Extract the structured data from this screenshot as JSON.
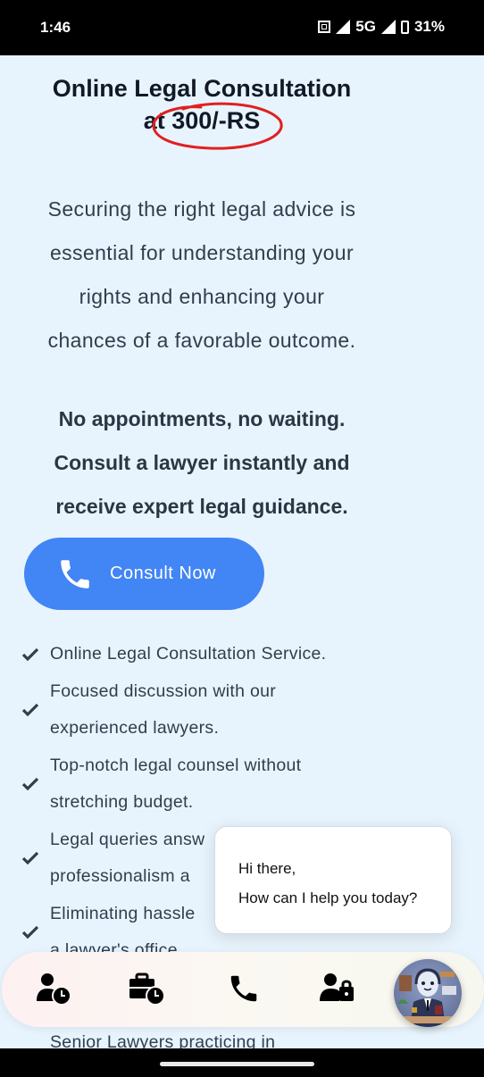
{
  "status_bar": {
    "time": "1:46",
    "network": "5G",
    "battery": "31%",
    "icons": [
      "nfc-icon",
      "signal-weak-icon",
      "signal-icon",
      "battery-icon"
    ]
  },
  "hero": {
    "title_line1": "Online Legal Consultation",
    "title_line2": "at 300/-RS",
    "price_highlight": "300/-RS",
    "highlight_color": "#e02020"
  },
  "intro": {
    "lines": [
      "Securing the right legal advice is",
      "essential for understanding your",
      "rights and enhancing your",
      "chances of a favorable outcome."
    ]
  },
  "bold_para": {
    "lines": [
      "No appointments, no waiting.",
      "Consult a lawyer instantly and",
      "receive expert legal guidance."
    ]
  },
  "cta": {
    "label": "Consult Now",
    "icon": "phone-icon",
    "color": "#4285f4"
  },
  "features": [
    {
      "lines": [
        "Online Legal Consultation Service."
      ]
    },
    {
      "lines": [
        "Focused discussion with our",
        "experienced lawyers."
      ]
    },
    {
      "lines": [
        "Top-notch legal counsel without",
        "stretching budget."
      ]
    },
    {
      "lines": [
        "Legal queries answ",
        "professionalism a"
      ]
    },
    {
      "lines": [
        "Eliminating hassle",
        "a lawyer's office."
      ]
    }
  ],
  "chat_bubble": {
    "line1": "Hi there,",
    "line2": "How can I help you today?"
  },
  "bottom_nav": {
    "items": [
      {
        "icon": "user-clock-icon"
      },
      {
        "icon": "briefcase-clock-icon"
      },
      {
        "icon": "phone-icon"
      },
      {
        "icon": "user-lock-icon"
      }
    ],
    "assistant_avatar": "lawyer-assistant-avatar"
  },
  "partial_text": "Senior Lawyers practicing in"
}
